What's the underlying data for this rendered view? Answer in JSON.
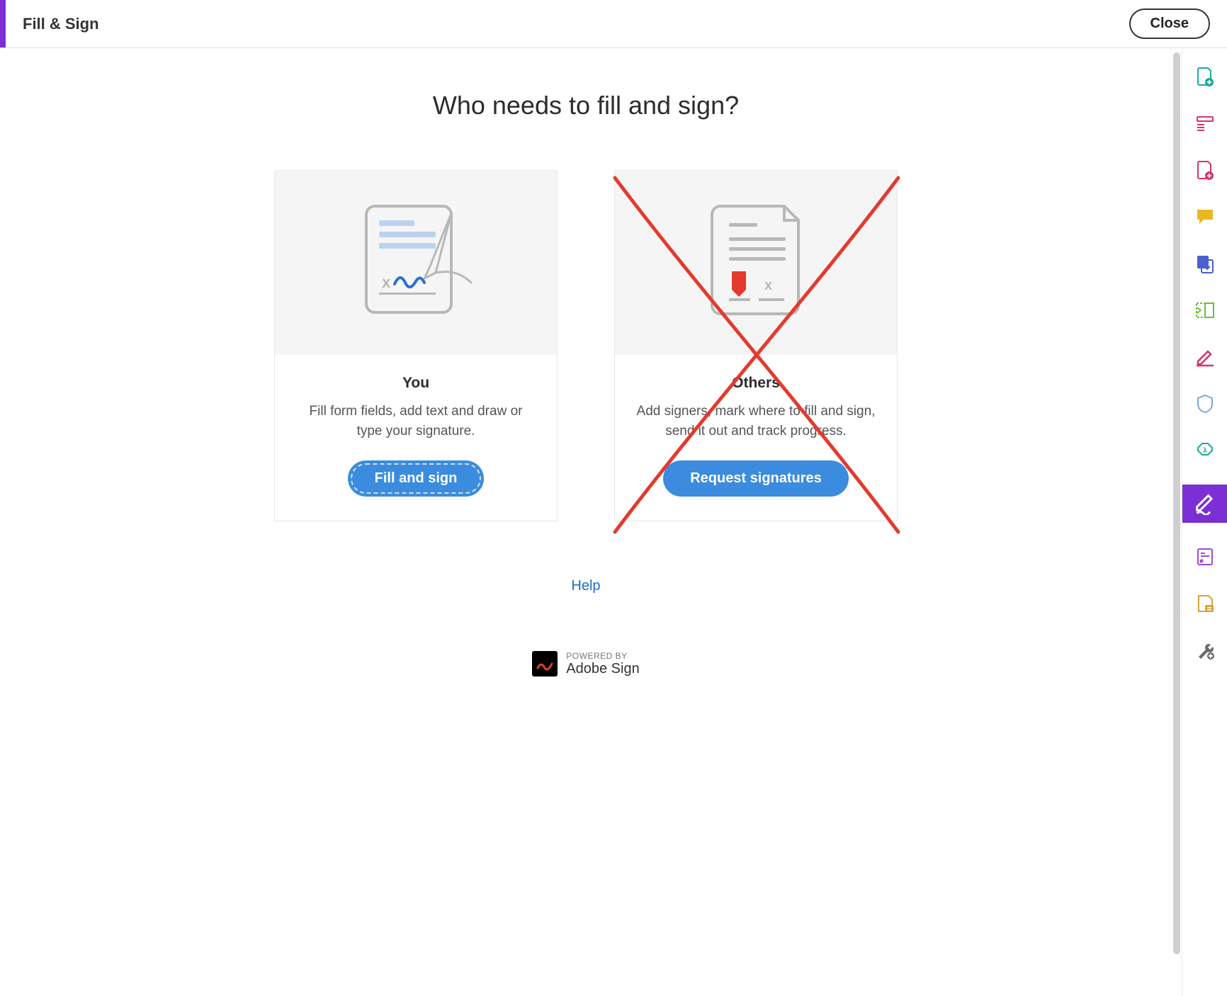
{
  "topbar": {
    "title": "Fill & Sign",
    "close_label": "Close"
  },
  "heading": "Who needs to fill and sign?",
  "cards": {
    "you": {
      "title": "You",
      "desc": "Fill form fields, add text and draw or type your signature.",
      "cta": "Fill and sign"
    },
    "others": {
      "title": "Others",
      "desc": "Add signers, mark where to fill and sign, send it out and track progress.",
      "cta": "Request signatures"
    }
  },
  "help_label": "Help",
  "powered": {
    "label": "POWERED BY",
    "brand": "Adobe Sign"
  },
  "sidebar_tools": [
    "export-pdf-icon",
    "organize-pages-icon",
    "create-pdf-icon",
    "comment-icon",
    "combine-files-icon",
    "redact-icon",
    "edit-pdf-icon",
    "protect-icon",
    "compress-icon",
    "fill-sign-icon",
    "stamp-icon",
    "compare-icon",
    "more-tools-icon"
  ],
  "colors": {
    "accent": "#7b2fd4",
    "primary_btn": "#3b8cde",
    "annotation_red": "#e23b2e"
  }
}
